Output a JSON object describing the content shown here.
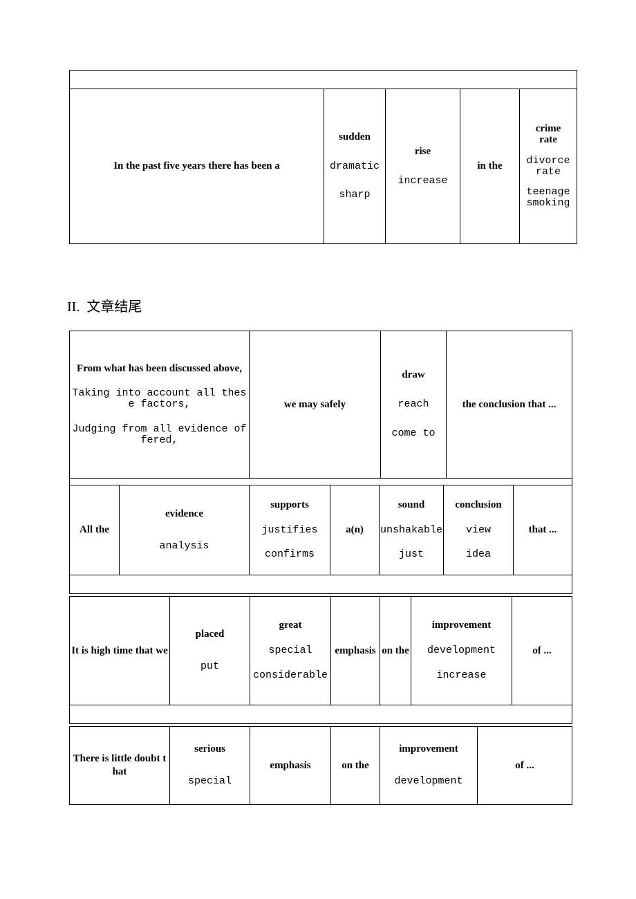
{
  "document": {
    "heading2": "II.  文章结尾"
  },
  "tables": {
    "t1": {
      "name": "opening-pattern-table",
      "columns": [
        {
          "key": "lead",
          "options": [
            "In the past five years there has been a"
          ]
        },
        {
          "key": "adj",
          "options": [
            "sudden",
            "dramatic",
            "sharp"
          ]
        },
        {
          "key": "noun",
          "options": [
            "rise",
            "increase"
          ]
        },
        {
          "key": "prep",
          "options": [
            "in the"
          ]
        },
        {
          "key": "topic",
          "options": [
            "crime rate",
            "divorce rate",
            "teenage smoking"
          ]
        }
      ],
      "cells": {
        "lead": "In the past five years there has been a",
        "adj_1": "sudden",
        "adj_2": "dramatic",
        "adj_3": "sharp",
        "noun_1": "rise",
        "noun_2": "increase",
        "prep": "in the",
        "topic_1a": "crime",
        "topic_1b": "rate",
        "topic_2a": "divorce",
        "topic_2b": "rate",
        "topic_3a": "teenage",
        "topic_3b": "smoking"
      }
    },
    "t2": {
      "name": "conclusion-pattern-table",
      "cells": {
        "lead_1": "From what has been discussed above,",
        "lead_2": "Taking into account all these factors,",
        "lead_3": "Judging from all evidence offered,",
        "modal": "we may safely",
        "verb_1": "draw",
        "verb_2": "reach",
        "verb_3": "come to",
        "object": "the conclusion that ..."
      }
    },
    "t3": {
      "name": "evidence-pattern-table",
      "cells": {
        "lead": "All the",
        "subject_1": "evidence",
        "subject_2": "analysis",
        "verb_1": "supports",
        "verb_2": "justifies",
        "verb_3": "confirms",
        "article": "a(n)",
        "adj_1": "sound",
        "adj_2": "unshakable",
        "adj_3": "just",
        "noun_1": "conclusion",
        "noun_2": "view",
        "noun_3": "idea",
        "tail": "that ..."
      }
    },
    "t4": {
      "name": "high-time-pattern-table",
      "cells": {
        "lead": "It is high time that we",
        "verb_1": "placed",
        "verb_2": "put",
        "adj_1": "great",
        "adj_2": "special",
        "adj_3": "considerable",
        "noun": "emphasis",
        "prep": "on the",
        "object_1": "improvement",
        "object_2": "development",
        "object_3": "increase",
        "tail": "of ..."
      }
    },
    "t5": {
      "name": "little-doubt-pattern-table",
      "cells": {
        "lead": "There is little doubt that",
        "adj_1": "serious",
        "adj_2": "special",
        "noun": "emphasis",
        "prep": "on the",
        "object_1": "improvement",
        "object_2": "development",
        "tail": "of ..."
      }
    }
  }
}
